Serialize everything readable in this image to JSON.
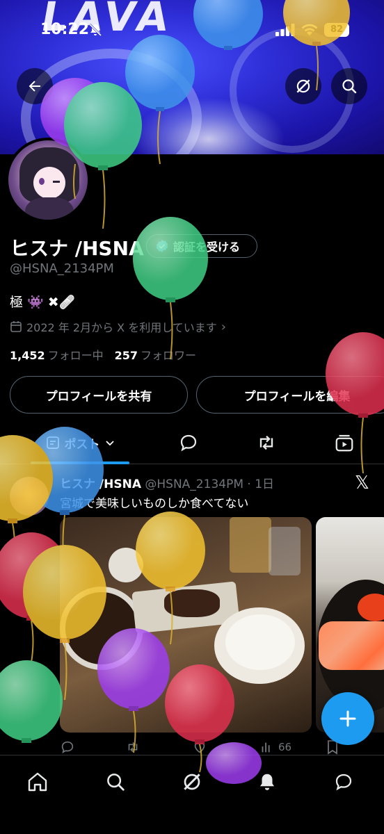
{
  "status_bar": {
    "time": "10:22",
    "battery": "82"
  },
  "banner": {
    "logo_text": "LAVA"
  },
  "profile": {
    "name": "ヒスナ /HSNA",
    "verify_label": "認証を受ける",
    "handle": "@HSNA_2134PM",
    "bio": "極 👾 ✖🩹",
    "joined": "2022 年 2月から X を利用しています",
    "following_count": "1,452",
    "following_label": "フォロー中",
    "followers_count": "257",
    "followers_label": "フォロワー",
    "share_label": "プロフィールを共有",
    "edit_label": "プロフィールを編集"
  },
  "tabs": {
    "posts_label": "ポスト"
  },
  "post": {
    "author": "ヒスナ /HSNA",
    "meta": "@HSNA_2134PM · 1日",
    "text": "宮城で美味しいものしか食べてない",
    "views": "66"
  },
  "icons": {
    "back": "back-arrow-icon",
    "grok": "grok-icon",
    "search": "search-icon",
    "calendar": "calendar-icon",
    "verified": "verified-badge-icon",
    "fab": "plus-icon",
    "nav": [
      "home-icon",
      "search-icon",
      "grok-icon",
      "notifications-icon",
      "messages-icon"
    ]
  },
  "colors": {
    "accent": "#1d9bf0",
    "background": "#000000",
    "muted": "#71767b"
  }
}
